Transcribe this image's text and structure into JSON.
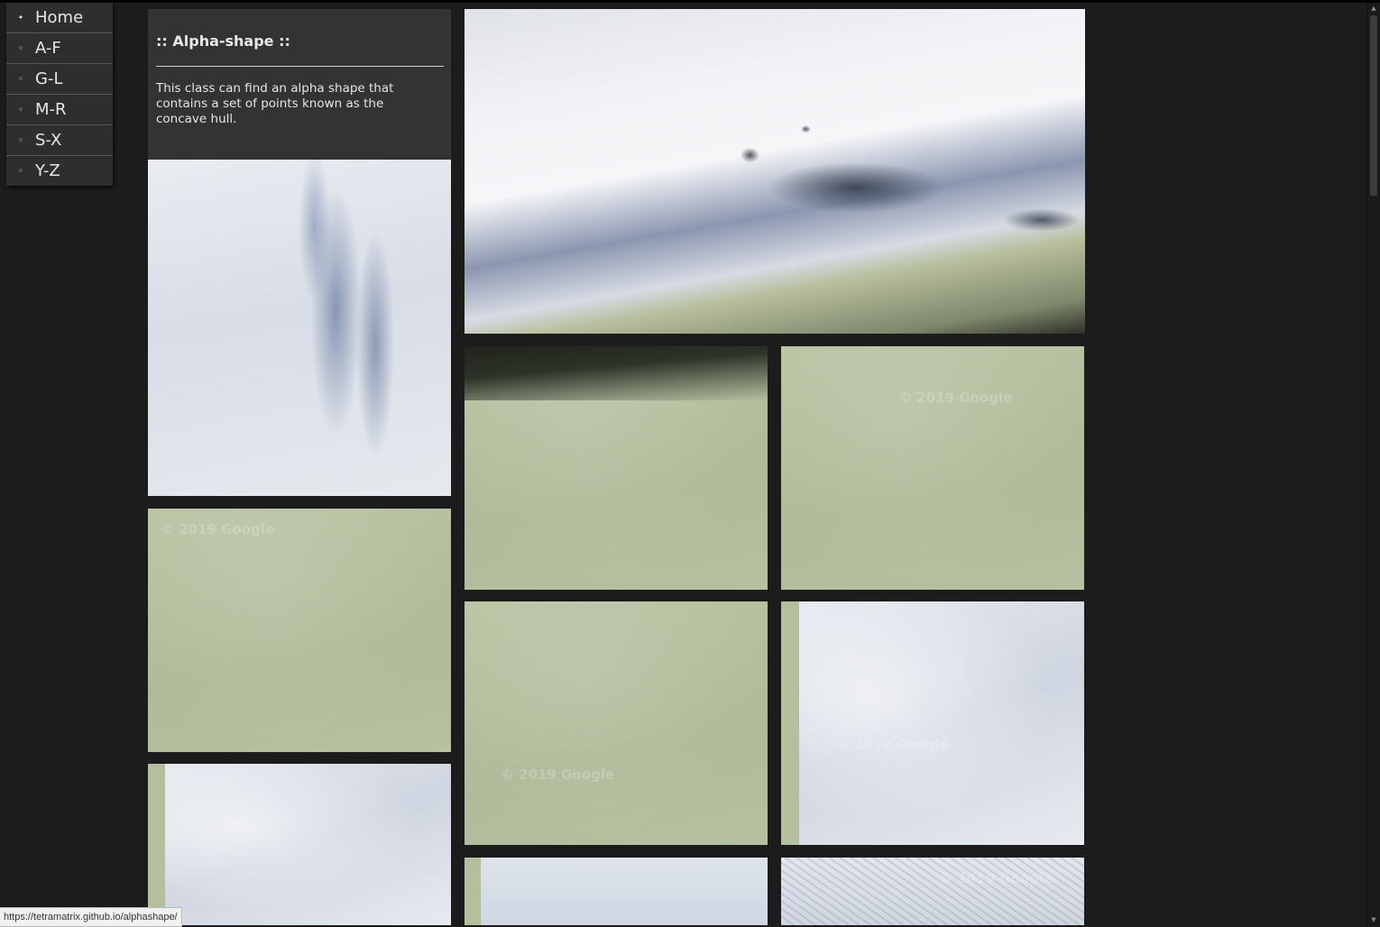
{
  "nav": {
    "items": [
      {
        "label": "Home",
        "bullet": "•"
      },
      {
        "label": "A-F",
        "bullet": "◦"
      },
      {
        "label": "G-L",
        "bullet": "◦"
      },
      {
        "label": "M-R",
        "bullet": "◦"
      },
      {
        "label": "S-X",
        "bullet": "◦"
      },
      {
        "label": "Y-Z",
        "bullet": "◦"
      }
    ]
  },
  "card": {
    "title": ":: Alpha-shape ::",
    "description": "This class can find an alpha shape that contains a set of points known as the concave hull."
  },
  "watermarks": {
    "text": "© 2019 Google"
  },
  "status": {
    "url": "https://tetramatrix.github.io/alphashape/"
  },
  "colors": {
    "background": "#1c1c1c",
    "card": "#333333",
    "snow": "#dfe3ea",
    "terrain": "#b3bf9e"
  }
}
